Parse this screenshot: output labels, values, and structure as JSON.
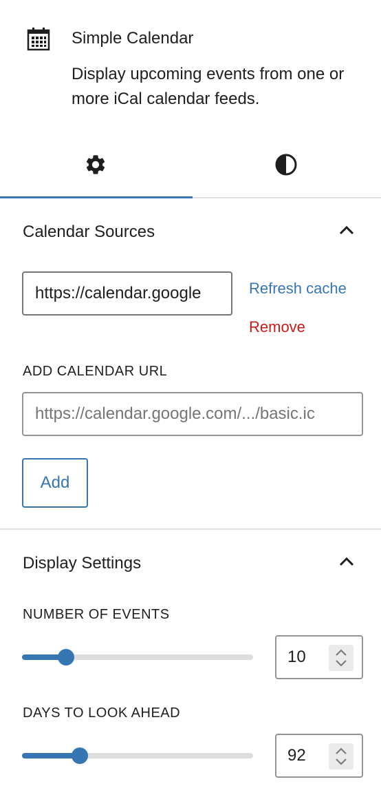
{
  "block": {
    "icon": "calendar-icon",
    "title": "Simple Calendar",
    "description": "Display upcoming events from one or more iCal calendar feeds."
  },
  "tabs": [
    {
      "name": "settings",
      "icon": "gear-icon",
      "active": true
    },
    {
      "name": "styles",
      "icon": "half-circle-contrast-icon",
      "active": false
    }
  ],
  "calendar_sources": {
    "title": "Calendar Sources",
    "expanded": true,
    "sources": [
      {
        "url": "https://calendar.google",
        "refresh_label": "Refresh cache",
        "remove_label": "Remove"
      }
    ],
    "add_label": "ADD CALENDAR URL",
    "add_placeholder": "https://calendar.google.com/.../basic.ic",
    "add_button": "Add"
  },
  "display_settings": {
    "title": "Display Settings",
    "expanded": true,
    "number_of_events": {
      "label": "NUMBER OF EVENTS",
      "value": "10",
      "fraction": 0.19
    },
    "days_to_look_ahead": {
      "label": "DAYS TO LOOK AHEAD",
      "value": "92",
      "fraction": 0.25
    }
  },
  "colors": {
    "accent": "#3676b3",
    "destructive": "#cc1818",
    "text": "#1e1e1e",
    "border": "#949494"
  }
}
